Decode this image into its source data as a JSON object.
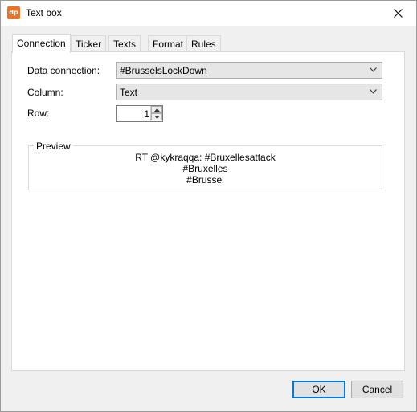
{
  "window": {
    "title": "Text box",
    "app_icon_text": "dp"
  },
  "tabs": [
    {
      "label": "Connection",
      "active": true
    },
    {
      "label": "Ticker",
      "active": false
    },
    {
      "label": "Texts",
      "active": false
    },
    {
      "label": "Format",
      "active": false
    },
    {
      "label": "Rules",
      "active": false
    }
  ],
  "connection": {
    "data_connection_label": "Data connection:",
    "data_connection_value": "#BrusselsLockDown",
    "column_label": "Column:",
    "column_value": "Text",
    "row_label": "Row:",
    "row_value": "1"
  },
  "preview": {
    "legend": "Preview",
    "lines": [
      "RT @kykraqqa: #Bruxellesattack",
      "#Bruxelles",
      "#Brussel"
    ]
  },
  "footer": {
    "ok_label": "OK",
    "cancel_label": "Cancel"
  },
  "colors": {
    "accent": "#0078d7",
    "app_icon": "#e8732a"
  },
  "icons": {
    "app": "dp-logo-icon",
    "close": "close-icon",
    "dropdown": "chevron-down-icon",
    "spin_up": "spin-up-icon",
    "spin_down": "spin-down-icon"
  }
}
